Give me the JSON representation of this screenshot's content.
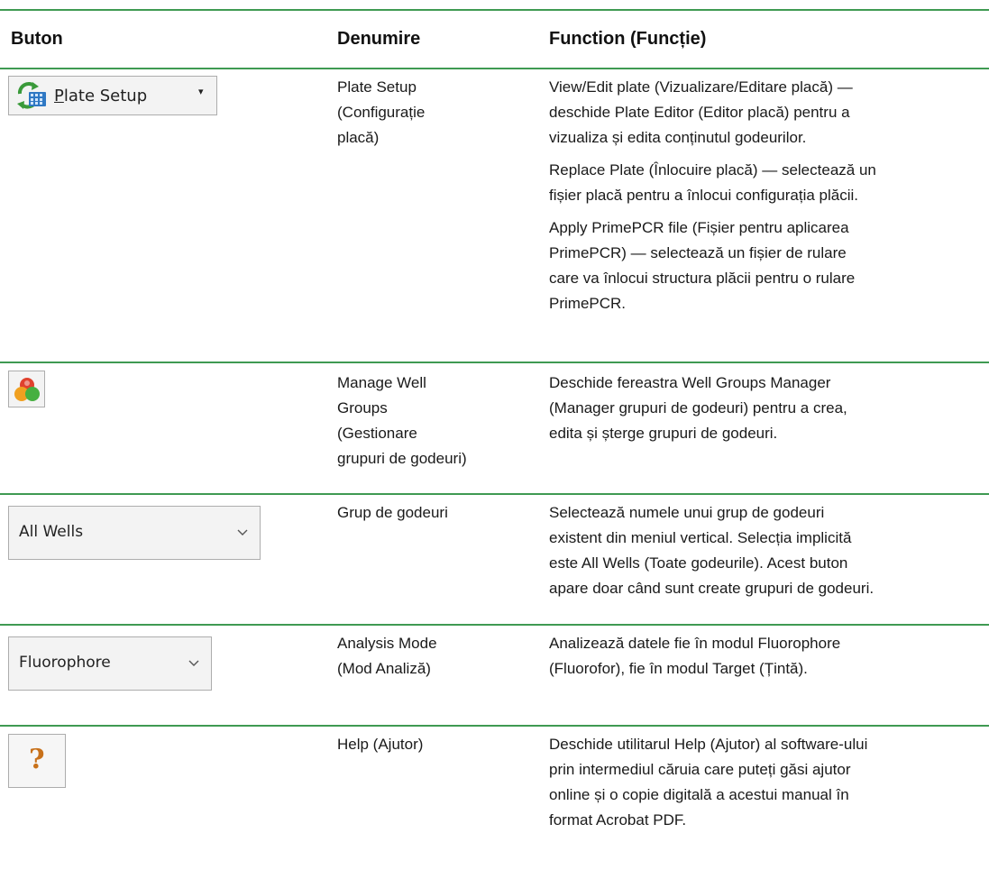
{
  "header": {
    "col1": "Buton",
    "col2": "Denumire",
    "col3": "Function (Funcție)"
  },
  "rows": [
    {
      "button": {
        "label": "Plate Setup",
        "icon": "plate-setup-icon",
        "dropdown": "▾"
      },
      "name": [
        "Plate Setup",
        "(Configurație",
        "placă)"
      ],
      "function": [
        [
          "View/Edit plate (Vizualizare/Editare placă) —",
          "deschide Plate Editor (Editor placă) pentru a",
          "vizualiza și edita conținutul godeurilor."
        ],
        [
          "Replace Plate (Înlocuire placă) — selectează un",
          "fișier placă pentru a înlocui configurația plăcii."
        ],
        [
          "Apply PrimePCR file (Fișier pentru aplicarea",
          "PrimePCR) — selectează un fișier de rulare",
          "care va înlocui structura plăcii pentru o rulare",
          "PrimePCR."
        ]
      ]
    },
    {
      "button": {
        "icon": "well-groups-icon"
      },
      "name": [
        "Manage Well",
        "Groups",
        "(Gestionare",
        "grupuri de godeuri)"
      ],
      "function": [
        [
          "Deschide fereastra Well Groups Manager",
          "(Manager grupuri de godeuri) pentru a crea,",
          "edita și șterge grupuri de godeuri."
        ]
      ]
    },
    {
      "button": {
        "value": "All Wells",
        "icon": "chevron-down-icon"
      },
      "name": [
        "Grup de godeuri"
      ],
      "function": [
        [
          "Selectează numele unui grup de godeuri",
          "existent din meniul vertical. Selecția implicită",
          "este All Wells (Toate godeurile). Acest buton",
          "apare doar când sunt create grupuri de godeuri."
        ]
      ]
    },
    {
      "button": {
        "value": "Fluorophore",
        "icon": "chevron-down-icon"
      },
      "name": [
        "Analysis Mode",
        "(Mod Analiză)"
      ],
      "function": [
        [
          "Analizează datele fie în modul Fluorophore",
          "(Fluorofor), fie în modul Target (Țintă)."
        ]
      ]
    },
    {
      "button": {
        "value": "?",
        "icon": "help-icon"
      },
      "name": [
        "Help (Ajutor)"
      ],
      "function": [
        [
          "Deschide utilitarul Help (Ajutor) al software-ului",
          "prin intermediul căruia care puteți găsi ajutor",
          "online și o copie digitală a acestui manual în",
          "format Acrobat PDF."
        ]
      ]
    }
  ],
  "colors": {
    "rule": "#3f9a52",
    "help_icon": "#c8711a"
  }
}
